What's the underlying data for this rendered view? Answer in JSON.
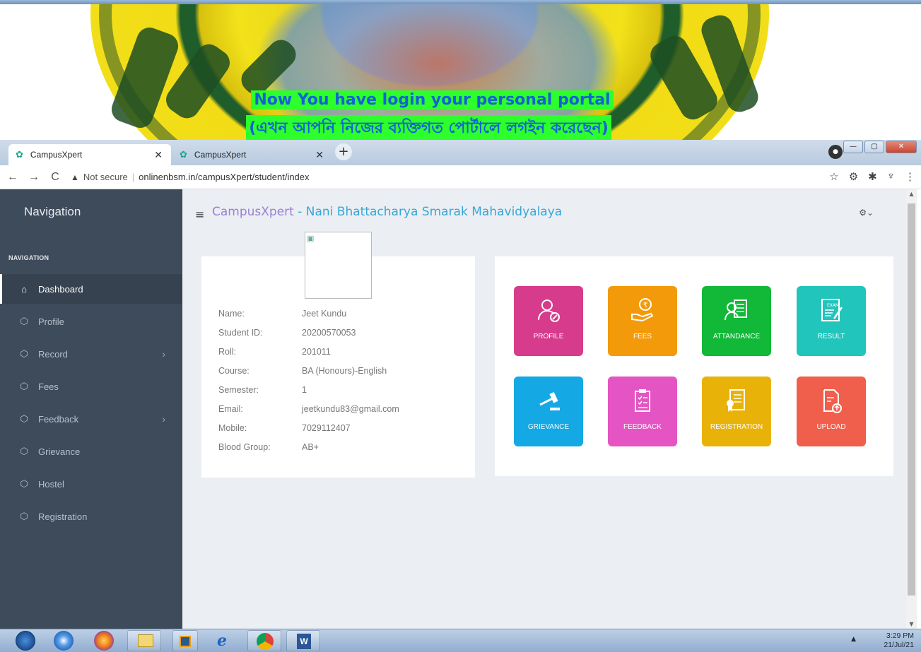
{
  "banner": {
    "line1": "Now You have login your personal portal",
    "line2": "(এখন আপনি নিজের ব্যক্তিগত পোর্টালে লগইন করেছেন)"
  },
  "browser": {
    "tabs": [
      {
        "label": "CampusXpert",
        "active": true
      },
      {
        "label": "CampusXpert",
        "active": false
      }
    ],
    "security_label": "Not secure",
    "url": "onlinenbsm.in/campusXpert/student/index"
  },
  "sidebar": {
    "title": "Navigation",
    "section": "NAVIGATION",
    "items": [
      {
        "label": "Dashboard",
        "icon": "home-icon",
        "active": true,
        "has_submenu": false
      },
      {
        "label": "Profile",
        "icon": "cube-icon",
        "active": false,
        "has_submenu": false
      },
      {
        "label": "Record",
        "icon": "cube-icon",
        "active": false,
        "has_submenu": true
      },
      {
        "label": "Fees",
        "icon": "cube-icon",
        "active": false,
        "has_submenu": false
      },
      {
        "label": "Feedback",
        "icon": "cube-icon",
        "active": false,
        "has_submenu": true
      },
      {
        "label": "Grievance",
        "icon": "cube-icon",
        "active": false,
        "has_submenu": false
      },
      {
        "label": "Hostel",
        "icon": "cube-icon",
        "active": false,
        "has_submenu": false
      },
      {
        "label": "Registration",
        "icon": "cube-icon",
        "active": false,
        "has_submenu": false
      }
    ]
  },
  "header": {
    "brand": "CampusXpert",
    "college": " - Nani Bhattacharya Smarak Mahavidyalaya"
  },
  "student": {
    "fields": [
      {
        "key": "Name:",
        "value": "Jeet Kundu"
      },
      {
        "key": "Student ID:",
        "value": "20200570053"
      },
      {
        "key": "Roll:",
        "value": "201011"
      },
      {
        "key": "Course:",
        "value": "BA (Honours)-English"
      },
      {
        "key": "Semester:",
        "value": "1"
      },
      {
        "key": "Email:",
        "value": "jeetkundu83@gmail.com"
      },
      {
        "key": "Mobile:",
        "value": "7029112407"
      },
      {
        "key": "Blood Group:",
        "value": "AB+"
      }
    ]
  },
  "tiles": [
    {
      "label": "PROFILE",
      "color": "#d63b8c",
      "icon": "user-edit-icon"
    },
    {
      "label": "FEES",
      "color": "#f39a0b",
      "icon": "rupee-hand-icon"
    },
    {
      "label": "ATTANDANCE",
      "color": "#12b838",
      "icon": "attendance-icon"
    },
    {
      "label": "RESULT",
      "color": "#22c5bb",
      "icon": "exam-result-icon"
    },
    {
      "label": "GRIEVANCE",
      "color": "#14a8e4",
      "icon": "gavel-icon"
    },
    {
      "label": "FEEDBACK",
      "color": "#e455c3",
      "icon": "clipboard-icon"
    },
    {
      "label": "REGISTRATION",
      "color": "#e9b208",
      "icon": "certificate-icon"
    },
    {
      "label": "UPLOAD",
      "color": "#f05f4c",
      "icon": "file-upload-icon"
    }
  ],
  "taskbar": {
    "time": "3:29 PM",
    "date": "21/Jul/21"
  }
}
